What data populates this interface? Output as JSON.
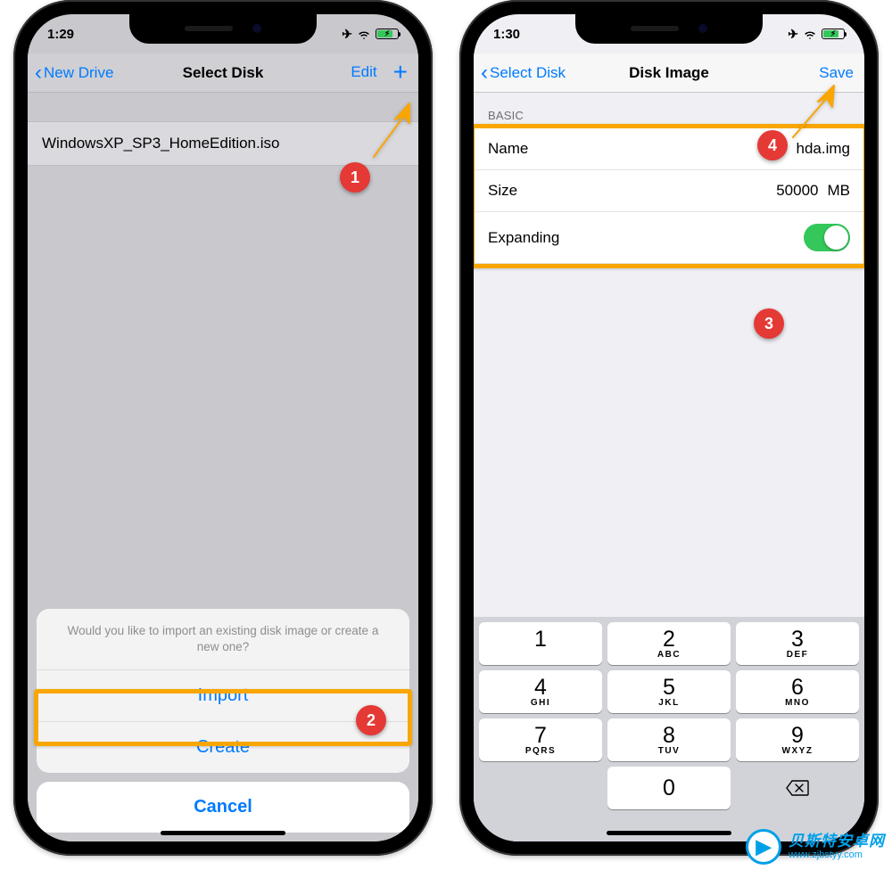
{
  "phone1": {
    "time": "1:29",
    "nav": {
      "back": "New Drive",
      "title": "Select Disk",
      "edit": "Edit"
    },
    "file_row": "WindowsXP_SP3_HomeEdition.iso",
    "sheet": {
      "message": "Would you like to import an existing disk image or create a new one?",
      "import": "Import",
      "create": "Create",
      "cancel": "Cancel"
    }
  },
  "phone2": {
    "time": "1:30",
    "nav": {
      "back": "Select Disk",
      "title": "Disk Image",
      "save": "Save"
    },
    "section": "BASIC",
    "form": {
      "name_label": "Name",
      "name_value": "hda.img",
      "size_label": "Size",
      "size_value": "50000",
      "size_unit": "MB",
      "expanding_label": "Expanding"
    },
    "keypad": {
      "rows": [
        [
          {
            "n": "1",
            "l": ""
          },
          {
            "n": "2",
            "l": "ABC"
          },
          {
            "n": "3",
            "l": "DEF"
          }
        ],
        [
          {
            "n": "4",
            "l": "GHI"
          },
          {
            "n": "5",
            "l": "JKL"
          },
          {
            "n": "6",
            "l": "MNO"
          }
        ],
        [
          {
            "n": "7",
            "l": "PQRS"
          },
          {
            "n": "8",
            "l": "TUV"
          },
          {
            "n": "9",
            "l": "WXYZ"
          }
        ]
      ],
      "zero": {
        "n": "0",
        "l": ""
      }
    }
  },
  "steps": {
    "s1": "1",
    "s2": "2",
    "s3": "3",
    "s4": "4"
  },
  "watermark": {
    "title": "贝斯特安卓网",
    "url": "www.zjbstyy.com"
  }
}
